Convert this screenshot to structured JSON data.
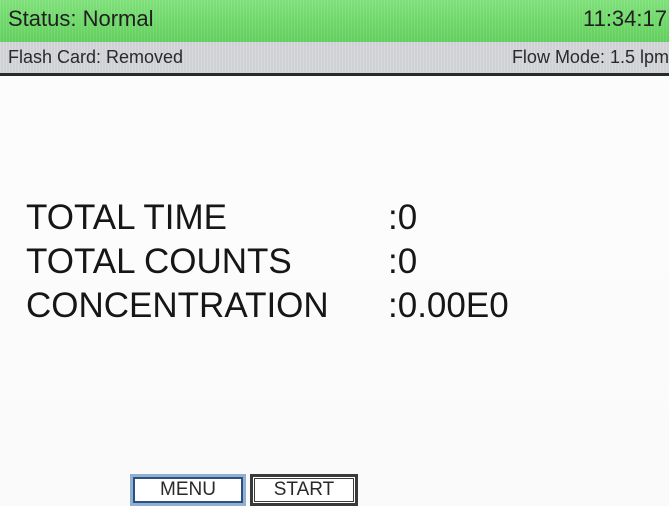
{
  "status_bar": {
    "status_label": "Status: Normal",
    "time": "11:34:17",
    "color": "#6fd86a"
  },
  "info_bar": {
    "flash_card": "Flash Card: Removed",
    "flow_mode": "Flow Mode: 1.5 lpm"
  },
  "readout": {
    "rows": [
      {
        "label": "TOTAL TIME",
        "value": ":0"
      },
      {
        "label": "TOTAL COUNTS",
        "value": ":0"
      },
      {
        "label": "CONCENTRATION",
        "value": ":0.00E0"
      }
    ]
  },
  "buttons": {
    "menu_label": "MENU",
    "start_label": "START"
  }
}
